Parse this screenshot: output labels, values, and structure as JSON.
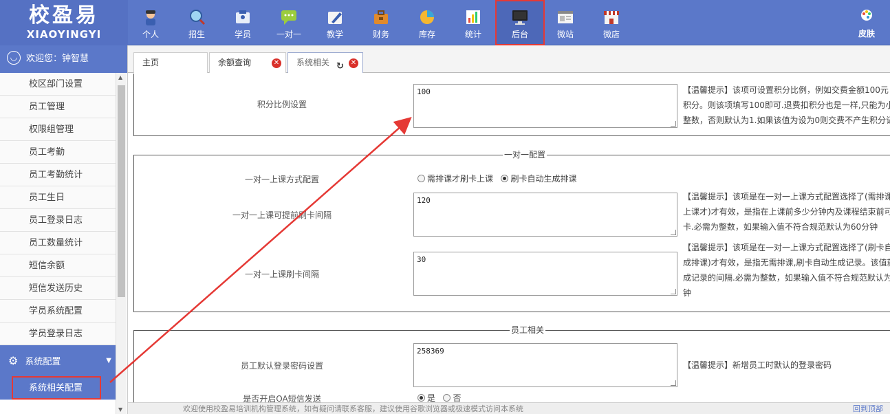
{
  "app": {
    "logo_cn": "校盈易",
    "logo_en": "XIAOYINGYI"
  },
  "nav": [
    {
      "label": "个人",
      "icon": "person-icon"
    },
    {
      "label": "招生",
      "icon": "search-person-icon"
    },
    {
      "label": "学员",
      "icon": "student-card-icon"
    },
    {
      "label": "一对一",
      "icon": "chat-bubble-icon"
    },
    {
      "label": "教学",
      "icon": "edit-book-icon"
    },
    {
      "label": "财务",
      "icon": "briefcase-icon"
    },
    {
      "label": "库存",
      "icon": "pie-chart-icon"
    },
    {
      "label": "统计",
      "icon": "bar-chart-icon"
    },
    {
      "label": "后台",
      "icon": "monitor-icon",
      "active": true
    },
    {
      "label": "微站",
      "icon": "webpage-icon"
    },
    {
      "label": "微店",
      "icon": "store-icon"
    }
  ],
  "skin_label": "皮肤",
  "sidebar": {
    "welcome": "欢迎您：钟智慧",
    "items": [
      "校区部门设置",
      "员工管理",
      "权限组管理",
      "员工考勤",
      "员工考勤统计",
      "员工生日",
      "员工登录日志",
      "员工数量统计",
      "短信余额",
      "短信发送历史",
      "学员系统配置",
      "学员登录日志"
    ],
    "group_label": "系统配置",
    "active_sub": "系统相关配置"
  },
  "tabs": [
    {
      "label": "主页"
    },
    {
      "label": "余额查询"
    },
    {
      "label": "系统相关"
    }
  ],
  "sections": {
    "points": {
      "label": "积分比例设置",
      "value": "100",
      "tip": "【温馨提示】该项可设置积分比例，例如交费金额100元积分。则该项填写100即可.退费扣积分也是一样,只能为小整数，否则默认为1.如果该值为设为0则交费不产生积分记"
    },
    "one_on_one": {
      "legend": "一对一配置",
      "mode_label": "一对一上课方式配置",
      "mode_options": [
        "需排课才刷卡上课",
        "刷卡自动生成排课"
      ],
      "mode_selected": 1,
      "early_label": "一对一上课可提前刷卡间隔",
      "early_value": "120",
      "early_tip": "【温馨提示】该项是在一对一上课方式配置选择了(需排课上课才)才有效，是指在上课前多少分钟内及课程结束前可卡.必需为整数，如果输入值不符合规范默认为60分钟",
      "interval_label": "一对一上课刷卡间隔",
      "interval_value": "30",
      "interval_tip": "【温馨提示】该项是在一对一上课方式配置选择了(刷卡自成排课)才有效，是指无需排课,刷卡自动生成记录。该值就成记录的间隔.必需为整数，如果输入值不符合规范默认为钟"
    },
    "staff": {
      "legend": "员工相关",
      "pwd_label": "员工默认登录密码设置",
      "pwd_value": "258369",
      "pwd_tip": "【温馨提示】新增员工时默认的登录密码",
      "oa_label": "是否开启OA短信发送",
      "oa_options": [
        "是",
        "否"
      ],
      "oa_selected": 0
    }
  },
  "footer": {
    "left": "欢迎使用校盈易培训机构管理系统，如有疑问请联系客服，建议使用谷歌浏览器或极速模式访问本系统",
    "right": "回到顶部"
  },
  "colors": {
    "primary": "#5b78c9",
    "highlight_red": "#e53935"
  }
}
